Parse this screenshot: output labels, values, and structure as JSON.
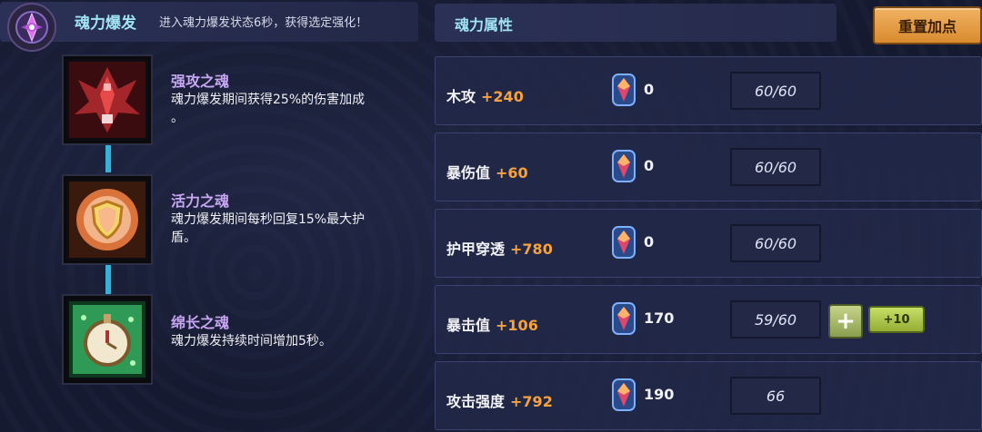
{
  "left_panel": {
    "title": "魂力爆发",
    "description": "进入魂力爆发状态6秒，获得选定强化！",
    "souls": [
      {
        "name": "强攻之魂",
        "desc_line1": "魂力爆发期间获得25%的伤害加成",
        "desc_line2": "。"
      },
      {
        "name": "活力之魂",
        "desc_line1": "魂力爆发期间每秒回复15%最大护",
        "desc_line2": "盾。"
      },
      {
        "name": "绵长之魂",
        "desc_line1": "魂力爆发持续时间增加5秒。",
        "desc_line2": ""
      }
    ]
  },
  "right_panel": {
    "title": "魂力属性",
    "reset_label": "重置加点",
    "attributes": [
      {
        "name": "木攻",
        "bonus": "+240",
        "points": "0",
        "cap": "60/60"
      },
      {
        "name": "暴伤值",
        "bonus": "+60",
        "points": "0",
        "cap": "60/60"
      },
      {
        "name": "护甲穿透",
        "bonus": "+780",
        "points": "0",
        "cap": "60/60"
      },
      {
        "name": "暴击值",
        "bonus": "+106",
        "points": "170",
        "cap": "59/60",
        "plus_label": "+",
        "plus10_label": "+10"
      },
      {
        "name": "攻击强度",
        "bonus": "+792",
        "points": "190",
        "cap": "66"
      }
    ]
  },
  "colors": {
    "accent_cyan": "#9fe3f5",
    "bonus_orange": "#f7a23a",
    "soul_name_purple": "#c7a6f2",
    "reset_button": "#e39a45",
    "plus_button_green": "#a9bf46"
  }
}
